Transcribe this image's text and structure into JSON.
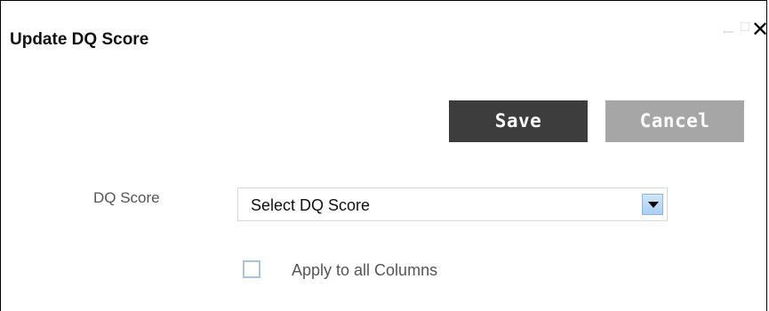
{
  "dialog": {
    "title": "Update DQ Score",
    "window_controls": [
      "minimize-icon",
      "maximize-icon",
      "close-icon"
    ],
    "close_glyph": "✕"
  },
  "actions": {
    "save_label": "Save",
    "cancel_label": "Cancel"
  },
  "form": {
    "dq_score_label": "DQ Score",
    "dq_score_select_value": "Select DQ Score",
    "apply_all_label": "Apply to all Columns",
    "apply_all_checked": false
  },
  "colors": {
    "save_button": "#3d3d3d",
    "cancel_button": "#a6a6a6",
    "checkbox_border": "#a8c3de",
    "dropdown_arrow_bg": "#a9cff3"
  }
}
